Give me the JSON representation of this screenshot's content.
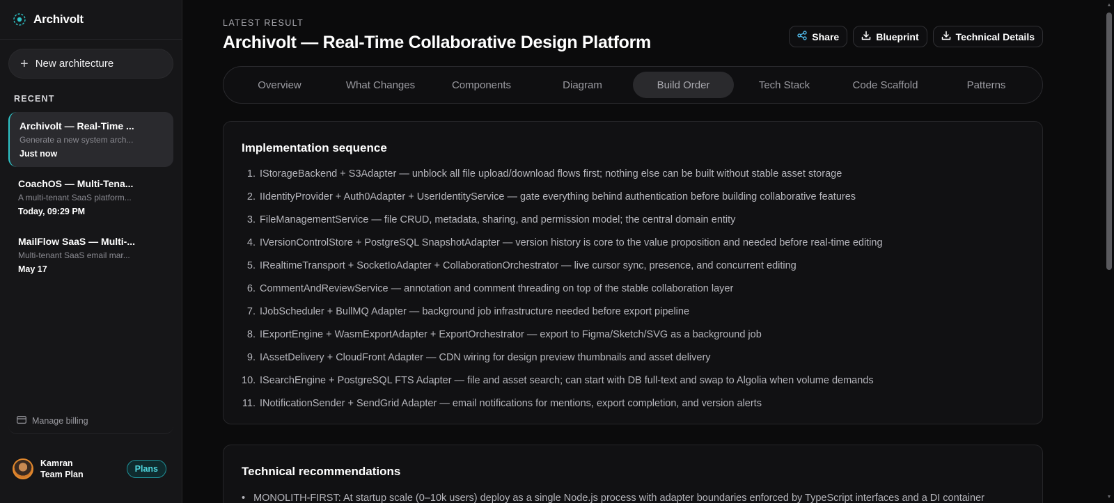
{
  "sidebar": {
    "brand": "Archivolt",
    "new_button": "New architecture",
    "recent_label": "RECENT",
    "recent": [
      {
        "title": "Archivolt — Real-Time ...",
        "desc": "Generate a new system arch...",
        "time": "Just now"
      },
      {
        "title": "CoachOS — Multi-Tena...",
        "desc": "A multi-tenant SaaS platform...",
        "time": "Today, 09:29 PM"
      },
      {
        "title": "MailFlow SaaS — Multi-...",
        "desc": "Multi-tenant SaaS email mar...",
        "time": "May 17"
      }
    ],
    "billing": "Manage billing",
    "user_name": "Kamran",
    "user_plan": "Team Plan",
    "plans_button": "Plans"
  },
  "header": {
    "eyebrow": "LATEST RESULT",
    "title": "Archivolt — Real-Time Collaborative Design Platform",
    "share": "Share",
    "blueprint": "Blueprint",
    "technical": "Technical Details"
  },
  "tabs": [
    "Overview",
    "What Changes",
    "Components",
    "Diagram",
    "Build Order",
    "Tech Stack",
    "Code Scaffold",
    "Patterns"
  ],
  "active_tab": "Build Order",
  "sequence": {
    "title": "Implementation sequence",
    "items": [
      "IStorageBackend + S3Adapter — unblock all file upload/download flows first; nothing else can be built without stable asset storage",
      "IIdentityProvider + Auth0Adapter + UserIdentityService — gate everything behind authentication before building collaborative features",
      "FileManagementService — file CRUD, metadata, sharing, and permission model; the central domain entity",
      "IVersionControlStore + PostgreSQL SnapshotAdapter — version history is core to the value proposition and needed before real-time editing",
      "IRealtimeTransport + SocketIoAdapter + CollaborationOrchestrator — live cursor sync, presence, and concurrent editing",
      "CommentAndReviewService — annotation and comment threading on top of the stable collaboration layer",
      "IJobScheduler + BullMQ Adapter — background job infrastructure needed before export pipeline",
      "IExportEngine + WasmExportAdapter + ExportOrchestrator — export to Figma/Sketch/SVG as a background job",
      "IAssetDelivery + CloudFront Adapter — CDN wiring for design preview thumbnails and asset delivery",
      "ISearchEngine + PostgreSQL FTS Adapter — file and asset search; can start with DB full-text and swap to Algolia when volume demands",
      "INotificationSender + SendGrid Adapter — email notifications for mentions, export completion, and version alerts"
    ]
  },
  "recommendations": {
    "title": "Technical recommendations",
    "items": [
      "MONOLITH-FIRST: At startup scale (0–10k users) deploy as a single Node.js process with adapter boundaries enforced by TypeScript interfaces and a DI container"
    ]
  },
  "colors": {
    "accent": "#2ec5c9",
    "share_icon": "#4fb7e6"
  }
}
